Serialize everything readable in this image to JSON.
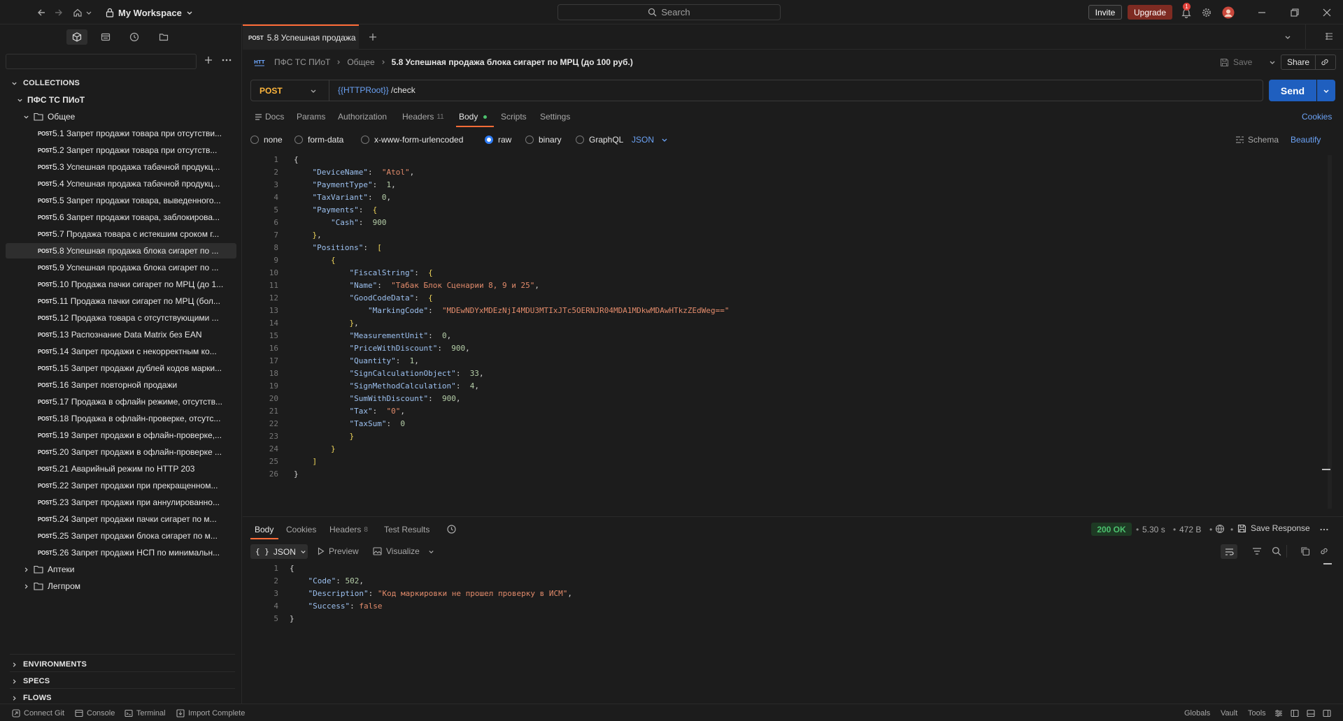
{
  "topbar": {
    "workspace": "My Workspace",
    "search_placeholder": "Search",
    "invite": "Invite",
    "upgrade": "Upgrade",
    "notifications_count": "1"
  },
  "sidebar": {
    "collections_label": "COLLECTIONS",
    "collection_name": "ПФС ТС ПИоТ",
    "folder_general": "Общее",
    "requests": [
      {
        "method": "POST",
        "name": "5.1 Запрет продажи товара при отсутстви..."
      },
      {
        "method": "POST",
        "name": "5.2 Запрет продажи товара при отсутств..."
      },
      {
        "method": "POST",
        "name": "5.3 Успешная продажа табачной продукц..."
      },
      {
        "method": "POST",
        "name": "5.4 Успешная продажа табачной продукц..."
      },
      {
        "method": "POST",
        "name": "5.5 Запрет продажи товара, выведенного..."
      },
      {
        "method": "POST",
        "name": "5.6 Запрет продажи товара, заблокирова..."
      },
      {
        "method": "POST",
        "name": "5.7 Продажа товара с истекшим сроком г..."
      },
      {
        "method": "POST",
        "name": "5.8 Успешная продажа блока сигарет по ..."
      },
      {
        "method": "POST",
        "name": "5.9 Успешная продажа блока сигарет по ..."
      },
      {
        "method": "POST",
        "name": "5.10 Продажа пачки сигарет по МРЦ (до 1..."
      },
      {
        "method": "POST",
        "name": "5.11 Продажа пачки сигарет по МРЦ (бол..."
      },
      {
        "method": "POST",
        "name": "5.12 Продажа товара с отсутствующими ..."
      },
      {
        "method": "POST",
        "name": "5.13 Распознание Data Matrix без EAN"
      },
      {
        "method": "POST",
        "name": "5.14 Запрет продажи с некорректным ко..."
      },
      {
        "method": "POST",
        "name": "5.15 Запрет продажи дублей кодов марки..."
      },
      {
        "method": "POST",
        "name": "5.16 Запрет повторной продажи"
      },
      {
        "method": "POST",
        "name": "5.17 Продажа в офлайн режиме, отсутств..."
      },
      {
        "method": "POST",
        "name": "5.18 Продажа в офлайн-проверке, отсутс..."
      },
      {
        "method": "POST",
        "name": "5.19 Запрет продажи в офлайн-проверке,..."
      },
      {
        "method": "POST",
        "name": "5.20 Запрет продажи в офлайн-проверке ..."
      },
      {
        "method": "POST",
        "name": "5.21 Аварийный режим по HTTP 203"
      },
      {
        "method": "POST",
        "name": "5.22 Запрет продажи при прекращенном..."
      },
      {
        "method": "POST",
        "name": "5.23 Запрет продажи при аннулированно..."
      },
      {
        "method": "POST",
        "name": "5.24 Запрет продажи пачки сигарет по м..."
      },
      {
        "method": "POST",
        "name": "5.25 Запрет продажи блока сигарет по м..."
      },
      {
        "method": "POST",
        "name": "5.26 Запрет продажи НСП по минимальн..."
      }
    ],
    "folder_pharmacy": "Аптеки",
    "folder_legprom": "Легпром",
    "environments_label": "ENVIRONMENTS",
    "specs_label": "SPECS",
    "flows_label": "FLOWS"
  },
  "tab": {
    "method": "POST",
    "title": "5.8 Успешная продажа"
  },
  "breadcrumb": {
    "collection": "ПФС ТС ПИоТ",
    "folder": "Общее",
    "current": "5.8 Успешная продажа блока сигарет по МРЦ (до 100 руб.)"
  },
  "actions": {
    "save": "Save",
    "share": "Share",
    "send": "Send",
    "cookies": "Cookies"
  },
  "request": {
    "method": "POST",
    "url_var": "{{HTTPRoot}}",
    "url_path": " /check",
    "tabs": {
      "docs": "Docs",
      "params": "Params",
      "authorization": "Authorization",
      "headers": "Headers",
      "headers_count": "11",
      "body": "Body",
      "scripts": "Scripts",
      "settings": "Settings"
    },
    "body_types": {
      "none": "none",
      "form_data": "form-data",
      "urlencoded": "x-www-form-urlencoded",
      "raw": "raw",
      "binary": "binary",
      "graphql": "GraphQL"
    },
    "body_format": "JSON",
    "schema": "Schema",
    "beautify": "Beautify"
  },
  "request_body_lines": [
    [
      [
        "p",
        "{"
      ]
    ],
    [
      [
        "p",
        "    "
      ],
      [
        "k",
        "\"DeviceName\""
      ],
      [
        "p",
        ":  "
      ],
      [
        "s",
        "\"Atol\""
      ],
      [
        "p",
        ","
      ]
    ],
    [
      [
        "p",
        "    "
      ],
      [
        "k",
        "\"PaymentType\""
      ],
      [
        "p",
        ":  "
      ],
      [
        "n",
        "1"
      ],
      [
        "p",
        ","
      ]
    ],
    [
      [
        "p",
        "    "
      ],
      [
        "k",
        "\"TaxVariant\""
      ],
      [
        "p",
        ":  "
      ],
      [
        "n",
        "0"
      ],
      [
        "p",
        ","
      ]
    ],
    [
      [
        "p",
        "    "
      ],
      [
        "k",
        "\"Payments\""
      ],
      [
        "p",
        ":  "
      ],
      [
        "b",
        "{"
      ]
    ],
    [
      [
        "p",
        "        "
      ],
      [
        "k",
        "\"Cash\""
      ],
      [
        "p",
        ":  "
      ],
      [
        "n",
        "900"
      ]
    ],
    [
      [
        "p",
        "    "
      ],
      [
        "b",
        "}"
      ],
      [
        "p",
        ","
      ]
    ],
    [
      [
        "p",
        "    "
      ],
      [
        "k",
        "\"Positions\""
      ],
      [
        "p",
        ":  "
      ],
      [
        "b",
        "["
      ]
    ],
    [
      [
        "p",
        "        "
      ],
      [
        "b",
        "{"
      ]
    ],
    [
      [
        "p",
        "            "
      ],
      [
        "k",
        "\"FiscalString\""
      ],
      [
        "p",
        ":  "
      ],
      [
        "b",
        "{"
      ]
    ],
    [
      [
        "p",
        "            "
      ],
      [
        "k",
        "\"Name\""
      ],
      [
        "p",
        ":  "
      ],
      [
        "s",
        "\"Табак Блок Сценарии 8, 9 и 25\""
      ],
      [
        "p",
        ","
      ]
    ],
    [
      [
        "p",
        "            "
      ],
      [
        "k",
        "\"GoodCodeData\""
      ],
      [
        "p",
        ":  "
      ],
      [
        "b",
        "{"
      ]
    ],
    [
      [
        "p",
        "                "
      ],
      [
        "k",
        "\"MarkingCode\""
      ],
      [
        "p",
        ":  "
      ],
      [
        "s",
        "\"MDEwNDYxMDEzNjI4MDU3MTIxJTc5OERNJR04MDA1MDkwMDAwHTkzZEdWeg==\""
      ]
    ],
    [
      [
        "p",
        "            "
      ],
      [
        "b",
        "}"
      ],
      [
        "p",
        ","
      ]
    ],
    [
      [
        "p",
        "            "
      ],
      [
        "k",
        "\"MeasurementUnit\""
      ],
      [
        "p",
        ":  "
      ],
      [
        "n",
        "0"
      ],
      [
        "p",
        ","
      ]
    ],
    [
      [
        "p",
        "            "
      ],
      [
        "k",
        "\"PriceWithDiscount\""
      ],
      [
        "p",
        ":  "
      ],
      [
        "n",
        "900"
      ],
      [
        "p",
        ","
      ]
    ],
    [
      [
        "p",
        "            "
      ],
      [
        "k",
        "\"Quantity\""
      ],
      [
        "p",
        ":  "
      ],
      [
        "n",
        "1"
      ],
      [
        "p",
        ","
      ]
    ],
    [
      [
        "p",
        "            "
      ],
      [
        "k",
        "\"SignCalculationObject\""
      ],
      [
        "p",
        ":  "
      ],
      [
        "n",
        "33"
      ],
      [
        "p",
        ","
      ]
    ],
    [
      [
        "p",
        "            "
      ],
      [
        "k",
        "\"SignMethodCalculation\""
      ],
      [
        "p",
        ":  "
      ],
      [
        "n",
        "4"
      ],
      [
        "p",
        ","
      ]
    ],
    [
      [
        "p",
        "            "
      ],
      [
        "k",
        "\"SumWithDiscount\""
      ],
      [
        "p",
        ":  "
      ],
      [
        "n",
        "900"
      ],
      [
        "p",
        ","
      ]
    ],
    [
      [
        "p",
        "            "
      ],
      [
        "k",
        "\"Tax\""
      ],
      [
        "p",
        ":  "
      ],
      [
        "s",
        "\"0\""
      ],
      [
        "p",
        ","
      ]
    ],
    [
      [
        "p",
        "            "
      ],
      [
        "k",
        "\"TaxSum\""
      ],
      [
        "p",
        ":  "
      ],
      [
        "n",
        "0"
      ]
    ],
    [
      [
        "p",
        "            "
      ],
      [
        "b",
        "}"
      ]
    ],
    [
      [
        "p",
        "        "
      ],
      [
        "b",
        "}"
      ]
    ],
    [
      [
        "p",
        "    "
      ],
      [
        "b",
        "]"
      ]
    ],
    [
      [
        "p",
        "}"
      ]
    ]
  ],
  "response": {
    "tabs": {
      "body": "Body",
      "cookies": "Cookies",
      "headers": "Headers",
      "headers_count": "8",
      "test_results": "Test Results"
    },
    "status": "200 OK",
    "time": "5.30 s",
    "size": "472 B",
    "save_response": "Save Response",
    "format": "JSON",
    "preview": "Preview",
    "visualize": "Visualize"
  },
  "response_body_lines": [
    [
      [
        "p",
        "{"
      ]
    ],
    [
      [
        "p",
        "    "
      ],
      [
        "k",
        "\"Code\""
      ],
      [
        "p",
        ": "
      ],
      [
        "n",
        "502"
      ],
      [
        "p",
        ","
      ]
    ],
    [
      [
        "p",
        "    "
      ],
      [
        "k",
        "\"Description\""
      ],
      [
        "p",
        ": "
      ],
      [
        "s",
        "\"Код маркировки не прошел проверку в ИСМ\""
      ],
      [
        "p",
        ","
      ]
    ],
    [
      [
        "p",
        "    "
      ],
      [
        "k",
        "\"Success\""
      ],
      [
        "p",
        ": "
      ],
      [
        "s",
        "false"
      ]
    ],
    [
      [
        "p",
        "}"
      ]
    ]
  ],
  "footer": {
    "connect_git": "Connect Git",
    "console": "Console",
    "terminal": "Terminal",
    "import_complete": "Import Complete",
    "globals": "Globals",
    "vault": "Vault",
    "tools": "Tools"
  },
  "colors": {
    "accent": "#ff6c37",
    "send": "#1f5fbf",
    "method_post": "#fdb53c",
    "status_ok": "#4cc16e"
  }
}
